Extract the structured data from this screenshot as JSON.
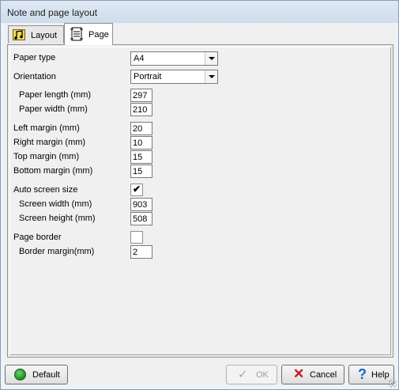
{
  "window": {
    "title": "Note and page layout"
  },
  "tabs": [
    {
      "label": "Layout",
      "icon": "music-notes-icon"
    },
    {
      "label": "Page",
      "icon": "page-ruler-icon"
    }
  ],
  "page": {
    "paper_type_label": "Paper type",
    "paper_type_value": "A4",
    "orientation_label": "Orientation",
    "orientation_value": "Portrait",
    "paper_length_label": "Paper length (mm)",
    "paper_length_value": "297",
    "paper_width_label": "Paper width (mm)",
    "paper_width_value": "210",
    "left_margin_label": "Left margin (mm)",
    "left_margin_value": "20",
    "right_margin_label": "Right margin (mm)",
    "right_margin_value": "10",
    "top_margin_label": "Top margin (mm)",
    "top_margin_value": "15",
    "bottom_margin_label": "Bottom margin (mm)",
    "bottom_margin_value": "15",
    "auto_screen_label": "Auto screen size",
    "auto_screen_checked": true,
    "screen_width_label": "Screen width (mm)",
    "screen_width_value": "903",
    "screen_height_label": "Screen height (mm)",
    "screen_height_value": "508",
    "page_border_label": "Page border",
    "page_border_checked": false,
    "border_margin_label": "Border margin(mm)",
    "border_margin_value": "2"
  },
  "buttons": {
    "default_label": "Default",
    "ok_label": "OK",
    "cancel_label": "Cancel",
    "help_label": "Help"
  },
  "colors": {
    "panel_bg": "#f0f0f0",
    "title_bg": "#dfe9f5",
    "cancel_icon": "#c8161b",
    "help_icon": "#1d66c7",
    "default_icon": "#1f8c1f"
  }
}
